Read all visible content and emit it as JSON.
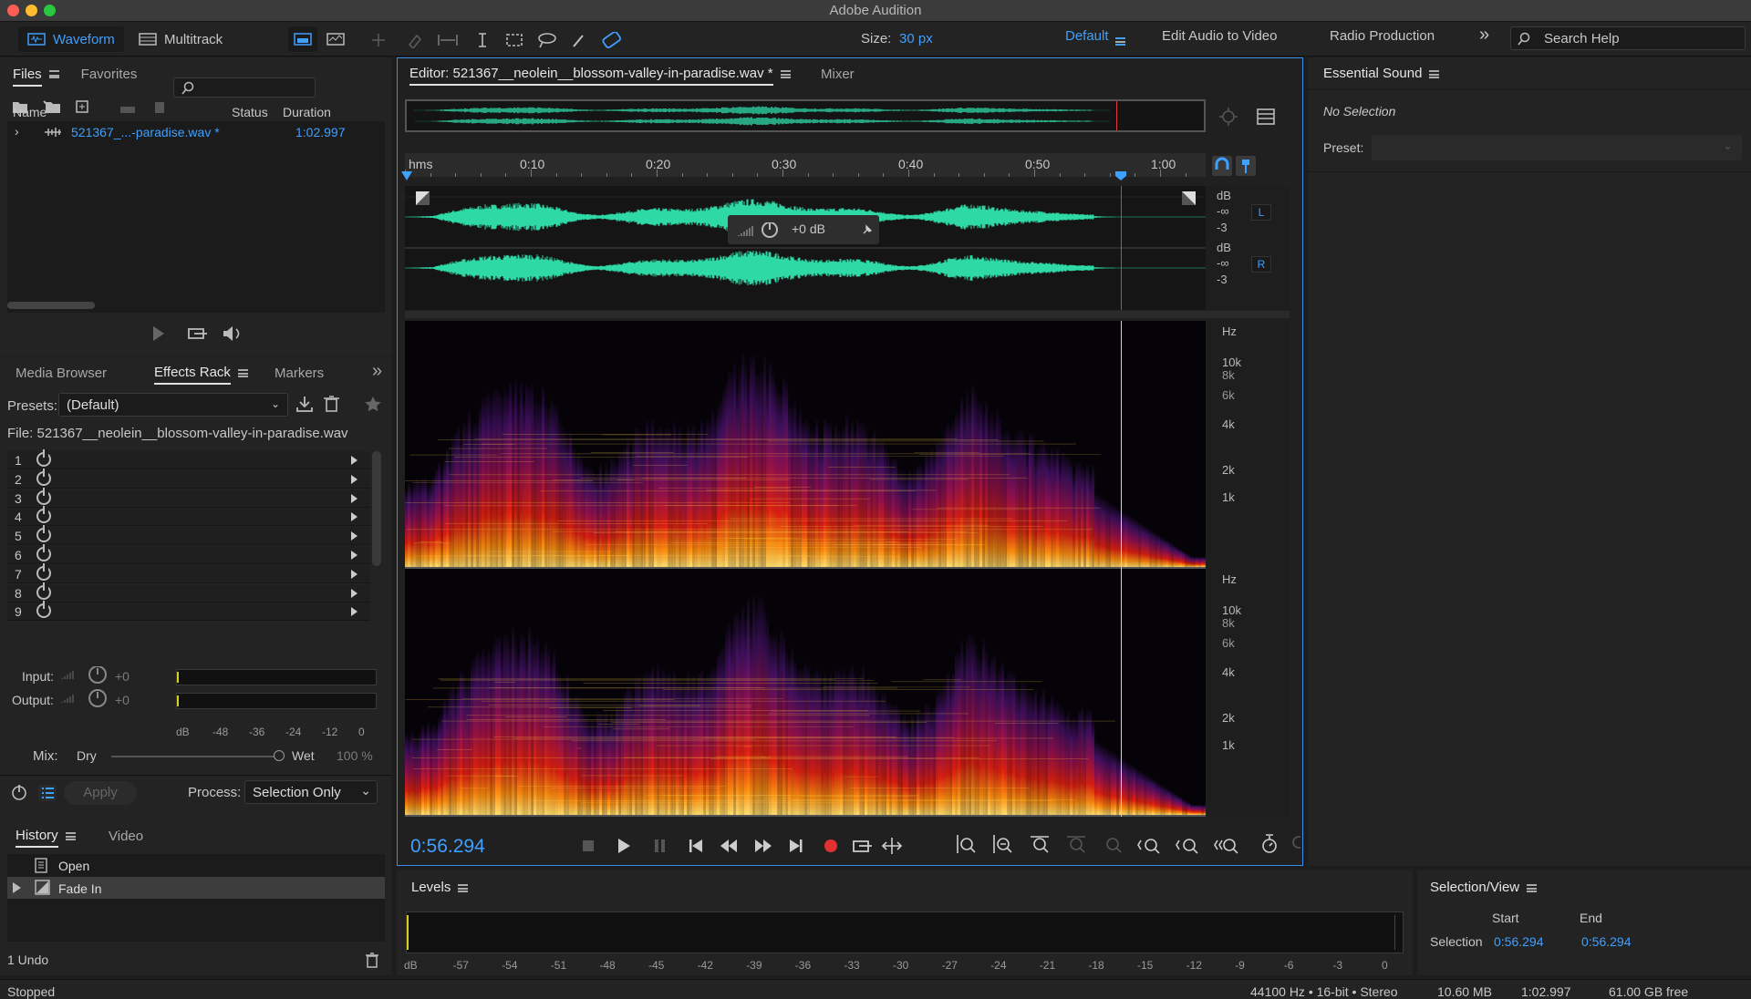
{
  "app": {
    "title": "Adobe Audition"
  },
  "toolbar": {
    "waveform": "Waveform",
    "multitrack": "Multitrack",
    "size_label": "Size:",
    "size_value": "30 px",
    "workspaces": [
      "Default",
      "Edit Audio to Video",
      "Radio Production"
    ],
    "more": "»",
    "search_placeholder": "Search Help"
  },
  "files_panel": {
    "tabs": [
      "Files",
      "Favorites"
    ],
    "columns": {
      "name": "Name",
      "status": "Status",
      "duration": "Duration"
    },
    "file": {
      "name": "521367_...-paradise.wav *",
      "duration": "1:02.997"
    }
  },
  "effects_panel": {
    "tabs": [
      "Media Browser",
      "Effects Rack",
      "Markers"
    ],
    "presets_label": "Presets:",
    "preset_value": "(Default)",
    "file_label": "File: 521367__neolein__blossom-valley-in-paradise.wav",
    "slots": [
      "1",
      "2",
      "3",
      "4",
      "5",
      "6",
      "7",
      "8",
      "9"
    ],
    "input_label": "Input:",
    "output_label": "Output:",
    "gain_value": "+0",
    "meter_ticks": [
      "dB",
      "-48",
      "-36",
      "-24",
      "-12",
      "0"
    ],
    "mix_label": "Mix:",
    "dry": "Dry",
    "wet": "Wet",
    "wet_pct": "100 %",
    "apply": "Apply",
    "process_label": "Process:",
    "process_value": "Selection Only"
  },
  "history_panel": {
    "tabs": [
      "History",
      "Video"
    ],
    "items": [
      "Open",
      "Fade In"
    ],
    "undo": "1 Undo"
  },
  "editor": {
    "tab": "Editor: 521367__neolein__blossom-valley-in-paradise.wav *",
    "mixer": "Mixer",
    "ruler": [
      "hms",
      "0:10",
      "0:20",
      "0:30",
      "0:40",
      "0:50",
      "1:00"
    ],
    "db_labels": [
      "dB",
      "-∞",
      "-3"
    ],
    "channel_l": "L",
    "channel_r": "R",
    "hud_gain": "+0 dB",
    "hz_labels": [
      "Hz",
      "10k",
      "8k",
      "6k",
      "4k",
      "2k",
      "1k"
    ],
    "playhead_fraction": 0.893,
    "time": "0:56.294"
  },
  "essential_sound": {
    "title": "Essential Sound",
    "selection": "No Selection",
    "preset_label": "Preset:"
  },
  "levels": {
    "title": "Levels",
    "ticks": [
      "dB",
      "-57",
      "-54",
      "-51",
      "-48",
      "-45",
      "-42",
      "-39",
      "-36",
      "-33",
      "-30",
      "-27",
      "-24",
      "-21",
      "-18",
      "-15",
      "-12",
      "-9",
      "-6",
      "-3",
      "0"
    ]
  },
  "selection_view": {
    "title": "Selection/View",
    "start_label": "Start",
    "end_label": "End",
    "row_label": "Selection",
    "start": "0:56.294",
    "end": "0:56.294"
  },
  "status": {
    "state": "Stopped",
    "format": "44100 Hz • 16-bit • Stereo",
    "size": "10.60 MB",
    "duration": "1:02.997",
    "free": "61.00 GB free"
  },
  "colors": {
    "accent": "#3ea0ff",
    "waveform": "#2fd9a6",
    "playhead": "#e03a3a"
  }
}
